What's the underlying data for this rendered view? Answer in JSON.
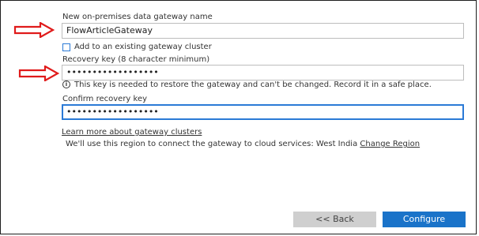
{
  "gateway_name": {
    "label": "New on-premises data gateway name",
    "value": "FlowArticleGateway"
  },
  "cluster": {
    "label": "Add to an existing gateway cluster",
    "checked": false
  },
  "recovery_key": {
    "label": "Recovery key (8 character minimum)",
    "value": "••••••••••••••••••",
    "info": "This key is needed to restore the gateway and can't be changed. Record it in a safe place.",
    "info_icon": "i"
  },
  "confirm_key": {
    "label": "Confirm recovery key",
    "value": "••••••••••••••••••"
  },
  "learn_more": "Learn more about gateway clusters",
  "region_text": "We'll use this region to connect the gateway to cloud services: West India",
  "change_region": "Change Region",
  "buttons": {
    "back": "<< Back",
    "configure": "Configure"
  },
  "colors": {
    "accent": "#1a73c9",
    "arrow": "#e01b1b"
  }
}
